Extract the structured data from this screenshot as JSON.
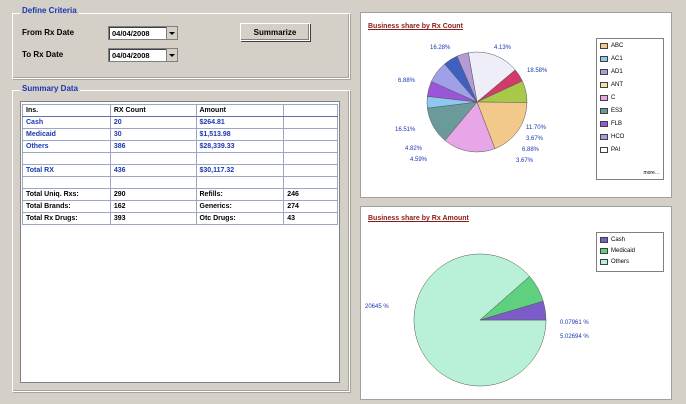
{
  "criteria": {
    "title": "Define Criteria",
    "from_label": "From Rx Date",
    "from_value": "04/04/2008",
    "to_label": "To Rx Date",
    "to_value": "04/04/2008",
    "summarize_label": "Summarize"
  },
  "summary": {
    "title": "Summary Data",
    "columns": [
      "Ins.",
      "RX Count",
      "Amount",
      ""
    ],
    "rows": [
      [
        "Cash",
        "20",
        "$264.81",
        ""
      ],
      [
        "Medicaid",
        "30",
        "$1,513.98",
        ""
      ],
      [
        "Others",
        "386",
        "$28,339.33",
        ""
      ],
      [
        "",
        "",
        "",
        ""
      ],
      [
        "Total RX",
        "436",
        "$30,117.32",
        ""
      ],
      [
        "",
        "",
        "",
        ""
      ],
      [
        "Total Uniq. Rxs:",
        "290",
        "Refills:",
        "246"
      ],
      [
        "Total Brands:",
        "162",
        "Generics:",
        "274"
      ],
      [
        "Total Rx Drugs:",
        "393",
        "Otc Drugs:",
        "43"
      ]
    ]
  },
  "chart_count": {
    "title": "Business share by Rx Count",
    "more_label": "more...",
    "legend": [
      "ABC",
      "AC1",
      "AD1",
      "ANT",
      "C",
      "ES3",
      "FLB",
      "HCO",
      "PAI"
    ],
    "legend_colors": [
      "#f2c98a",
      "#8ec8f0",
      "#b39ad8",
      "#f5e0a0",
      "#e7a6e7",
      "#6a9a9a",
      "#9a55d8",
      "#a0a0e8",
      "#ffffff"
    ],
    "labels": [
      "16.28%",
      "4.13%",
      "6.88%",
      "18.58%",
      "16.51%",
      "11.70%",
      "3.67%",
      "4.82%",
      "6.88%",
      "4.59%",
      "3.67%"
    ]
  },
  "chart_amount": {
    "title": "Business share by Rx Amount",
    "legend": [
      "Cash",
      "Medicaid",
      "Others"
    ],
    "legend_colors": [
      "#7b5cc9",
      "#5fd07d",
      "#b8f0d8"
    ],
    "labels": [
      "20645 %",
      "0.07961 %",
      "5.02694 %"
    ]
  },
  "chart_data": [
    {
      "type": "pie",
      "title": "Business share by Rx Count",
      "categories": [
        "ABC",
        "AC1",
        "AD1",
        "ANT",
        "C",
        "ES3",
        "FLB",
        "HCO",
        "PAI"
      ],
      "labels": [
        "16.28%",
        "4.13%",
        "6.88%",
        "18.58%",
        "16.51%",
        "11.70%",
        "3.67%",
        "4.82%",
        "6.88%",
        "4.59%",
        "3.67%"
      ],
      "legend": "right"
    },
    {
      "type": "pie",
      "title": "Business share by Rx Amount",
      "categories": [
        "Cash",
        "Medicaid",
        "Others"
      ],
      "values": [
        20,
        30,
        386
      ],
      "labels": [
        "20645 %",
        "0.07961 %",
        "5.02694 %"
      ],
      "legend": "top-right"
    }
  ]
}
